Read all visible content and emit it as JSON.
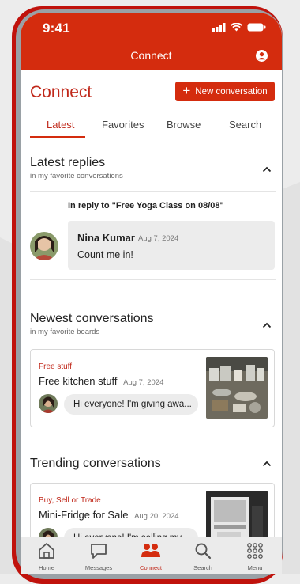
{
  "status_bar": {
    "time": "9:41"
  },
  "app_bar": {
    "title": "Connect"
  },
  "page": {
    "title": "Connect",
    "new_button_label": "New conversation"
  },
  "tabs": [
    {
      "label": "Latest",
      "active": true
    },
    {
      "label": "Favorites",
      "active": false
    },
    {
      "label": "Browse",
      "active": false
    },
    {
      "label": "Search",
      "active": false
    }
  ],
  "latest_replies": {
    "title": "Latest replies",
    "subtitle": "in my favorite conversations",
    "reply_to": "In reply to \"Free Yoga Class on 08/08\"",
    "reply": {
      "author": "Nina Kumar",
      "date": "Aug 7, 2024",
      "text": "Count me in!"
    }
  },
  "newest_conversations": {
    "title": "Newest conversations",
    "subtitle": "in my favorite boards",
    "card": {
      "category": "Free stuff",
      "title": "Free kitchen stuff",
      "date": "Aug 7, 2024",
      "snippet": "Hi everyone! I'm giving awa..."
    }
  },
  "trending_conversations": {
    "title": "Trending conversations",
    "card": {
      "category": "Buy, Sell or Trade",
      "title": "Mini-Fridge for Sale",
      "date": "Aug 20, 2024",
      "snippet": "Hi everyone! I'm selling my..."
    }
  },
  "bottom_nav": [
    {
      "label": "Home",
      "icon": "home-icon"
    },
    {
      "label": "Messages",
      "icon": "messages-icon"
    },
    {
      "label": "Connect",
      "icon": "people-icon",
      "active": true
    },
    {
      "label": "Search",
      "icon": "search-icon"
    },
    {
      "label": "Menu",
      "icon": "grid-icon"
    }
  ],
  "colors": {
    "brand": "#d42c0e",
    "accent_text": "#c0281a"
  }
}
